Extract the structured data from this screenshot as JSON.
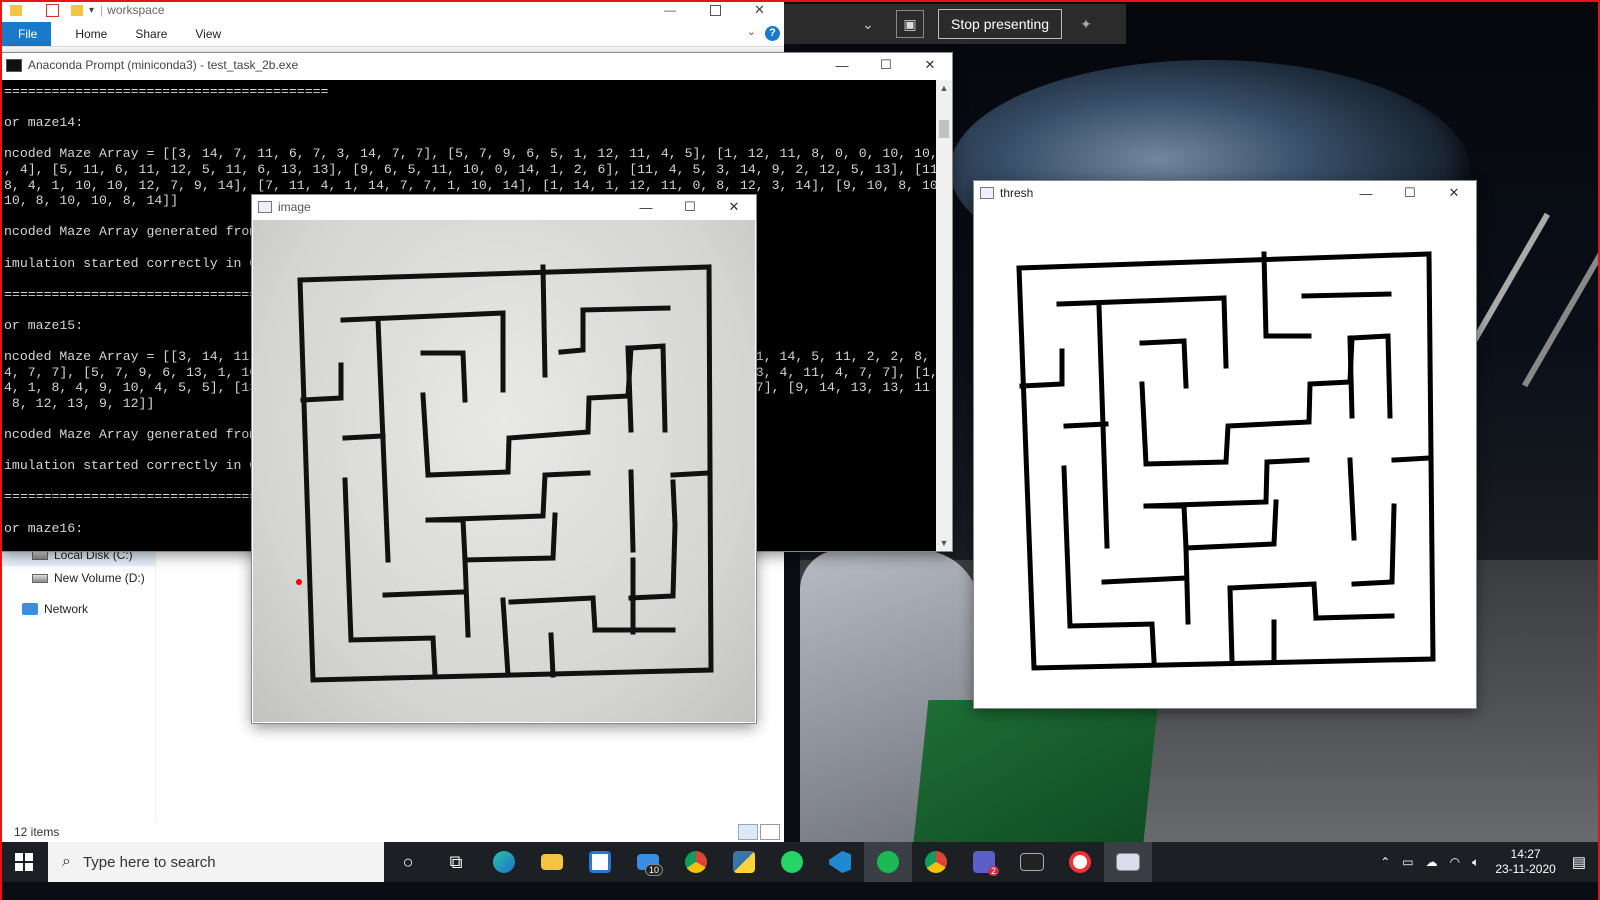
{
  "explorer": {
    "title": "workspace",
    "ribbon": {
      "file": "File",
      "home": "Home",
      "share": "Share",
      "view": "View",
      "help": "?"
    },
    "nav": {
      "local_disk": "Local Disk (C:)",
      "new_volume": "New Volume (D:)",
      "network": "Network"
    },
    "status": "12 items"
  },
  "console": {
    "title": "Anaconda Prompt (miniconda3) - test_task_2b.exe",
    "lines": [
      "=========================================",
      "",
      "or maze14:",
      "",
      "ncoded Maze Array = [[3, 14, 7, 11, 6, 7, 3, 14, 7, 7], [5, 7, 9, 6, 5, 1, 12, 11, 4, 5], [1, 12, 11, 8, 0, 0, 10, 10,",
      ", 4], [5, 11, 6, 11, 12, 5, 11, 6, 13, 13], [9, 6, 5, 11, 10, 0, 14, 1, 2, 6], [11, 4, 5, 3, 14, 9, 2, 12, 5, 13], [11,",
      "8, 4, 1, 10, 10, 12, 7, 9, 14], [7, 11, 4, 1, 14, 7, 7, 1, 10, 14], [1, 14, 1, 12, 11, 0, 8, 12, 3, 14], [9, 10, 8, 10,",
      "10, 8, 10, 10, 8, 14]]",
      "",
      "ncoded Maze Array generated from",
      "",
      "imulation started correctly in C",
      "",
      "=========================================",
      "",
      "or maze15:",
      "",
      "ncoded Maze Array = [[3, 14, 11,                                                               1, 14, 5, 11, 2, 2, 8,",
      "4, 7, 7], [5, 7, 9, 6, 13, 1, 10                                                               3, 4, 11, 4, 7, 7], [1,",
      "4, 1, 8, 4, 9, 10, 4, 5, 5], [13                                                               7], [9, 14, 13, 13, 11",
      " 8, 12, 13, 9, 12]]",
      "",
      "ncoded Maze Array generated from",
      "",
      "imulation started correctly in C",
      "",
      "=========================================",
      "",
      "or maze16:"
    ]
  },
  "present": {
    "stop": "Stop presenting"
  },
  "image_window": {
    "title": "image"
  },
  "thresh_window": {
    "title": "thresh"
  },
  "taskbar": {
    "search_placeholder": "Type here to search",
    "mail_badge": "10",
    "teams_badge": "2",
    "time": "14:27",
    "date": "23-11-2020"
  }
}
